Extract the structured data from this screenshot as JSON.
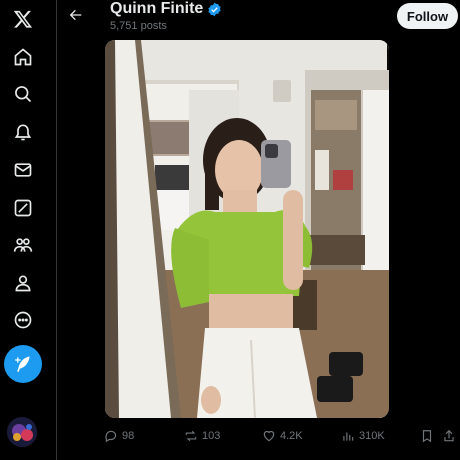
{
  "profile": {
    "name": "Quinn Finite",
    "posts_count": "5,751 posts",
    "verified": true,
    "follow_label": "Follow"
  },
  "nav": {
    "items": [
      "x-logo-icon",
      "home-icon",
      "search-icon",
      "notifications-icon",
      "messages-icon",
      "grok-icon",
      "communities-icon",
      "profile-icon",
      "more-icon"
    ]
  },
  "actions": {
    "replies": "98",
    "reposts": "103",
    "likes": "4.2K",
    "views": "310K"
  },
  "colors": {
    "accent": "#1d9bf0",
    "text": "#e7e9ea",
    "muted": "#71767b",
    "background": "#000000"
  }
}
